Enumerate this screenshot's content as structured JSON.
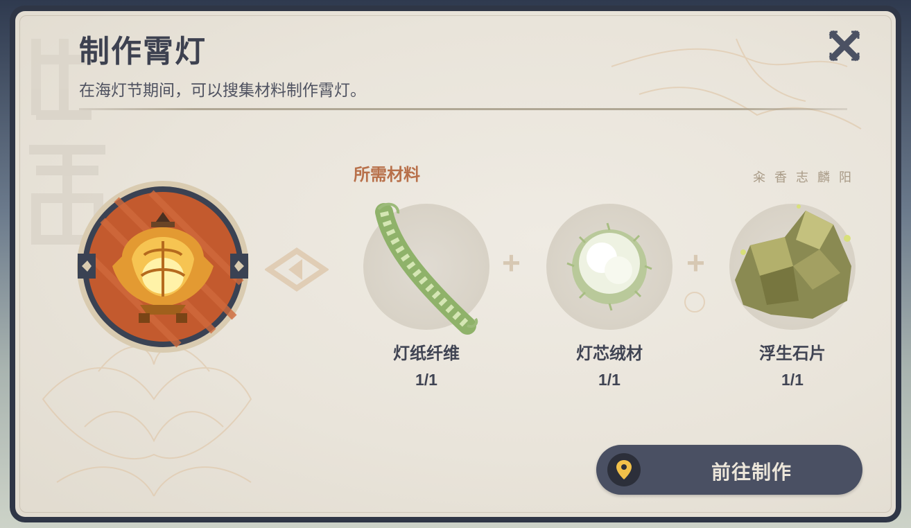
{
  "dialog": {
    "title": "制作霄灯",
    "subtitle": "在海灯节期间，可以搜集材料制作霄灯。",
    "close_icon": "close-x-icon",
    "hint": "籴 香 志 麟 阳"
  },
  "recipe": {
    "result_icon": "lantern-icon",
    "arrow_icon": "craft-arrow-icon",
    "required_label": "所需材料",
    "materials": [
      {
        "name": "灯纸纤维",
        "count": "1/1",
        "icon": "fiber-icon"
      },
      {
        "name": "灯芯绒材",
        "count": "1/1",
        "icon": "cotton-icon"
      },
      {
        "name": "浮生石片",
        "count": "1/1",
        "icon": "stone-icon"
      }
    ]
  },
  "action": {
    "label": "前往制作",
    "icon": "location-pin-icon"
  },
  "colors": {
    "accent": "#b8704a",
    "button": "#4a5063",
    "pin": "#f2c14a"
  }
}
